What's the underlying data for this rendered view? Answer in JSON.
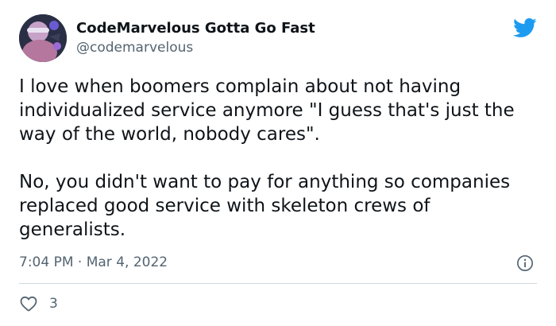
{
  "colors": {
    "twitter_blue": "#1d9bf0",
    "text_primary": "#0f1419",
    "text_secondary": "#536471",
    "divider": "#cfd9de"
  },
  "user": {
    "display_name": "CodeMarvelous Gotta Go Fast",
    "handle": "@codemarvelous",
    "avatar_icon": "profile-avatar"
  },
  "tweet": {
    "text": "I love when boomers complain about not having individualized service anymore \"I guess that's just the way of the world, nobody cares\".\n\nNo, you didn't want to pay for anything so companies replaced good service with skeleton crews of generalists.",
    "time": "7:04 PM",
    "separator": "·",
    "date": "Mar 4, 2022"
  },
  "actions": {
    "like_icon": "heart-icon",
    "like_count": "3"
  },
  "icons": {
    "brand": "twitter-bird-icon",
    "info": "info-icon"
  }
}
